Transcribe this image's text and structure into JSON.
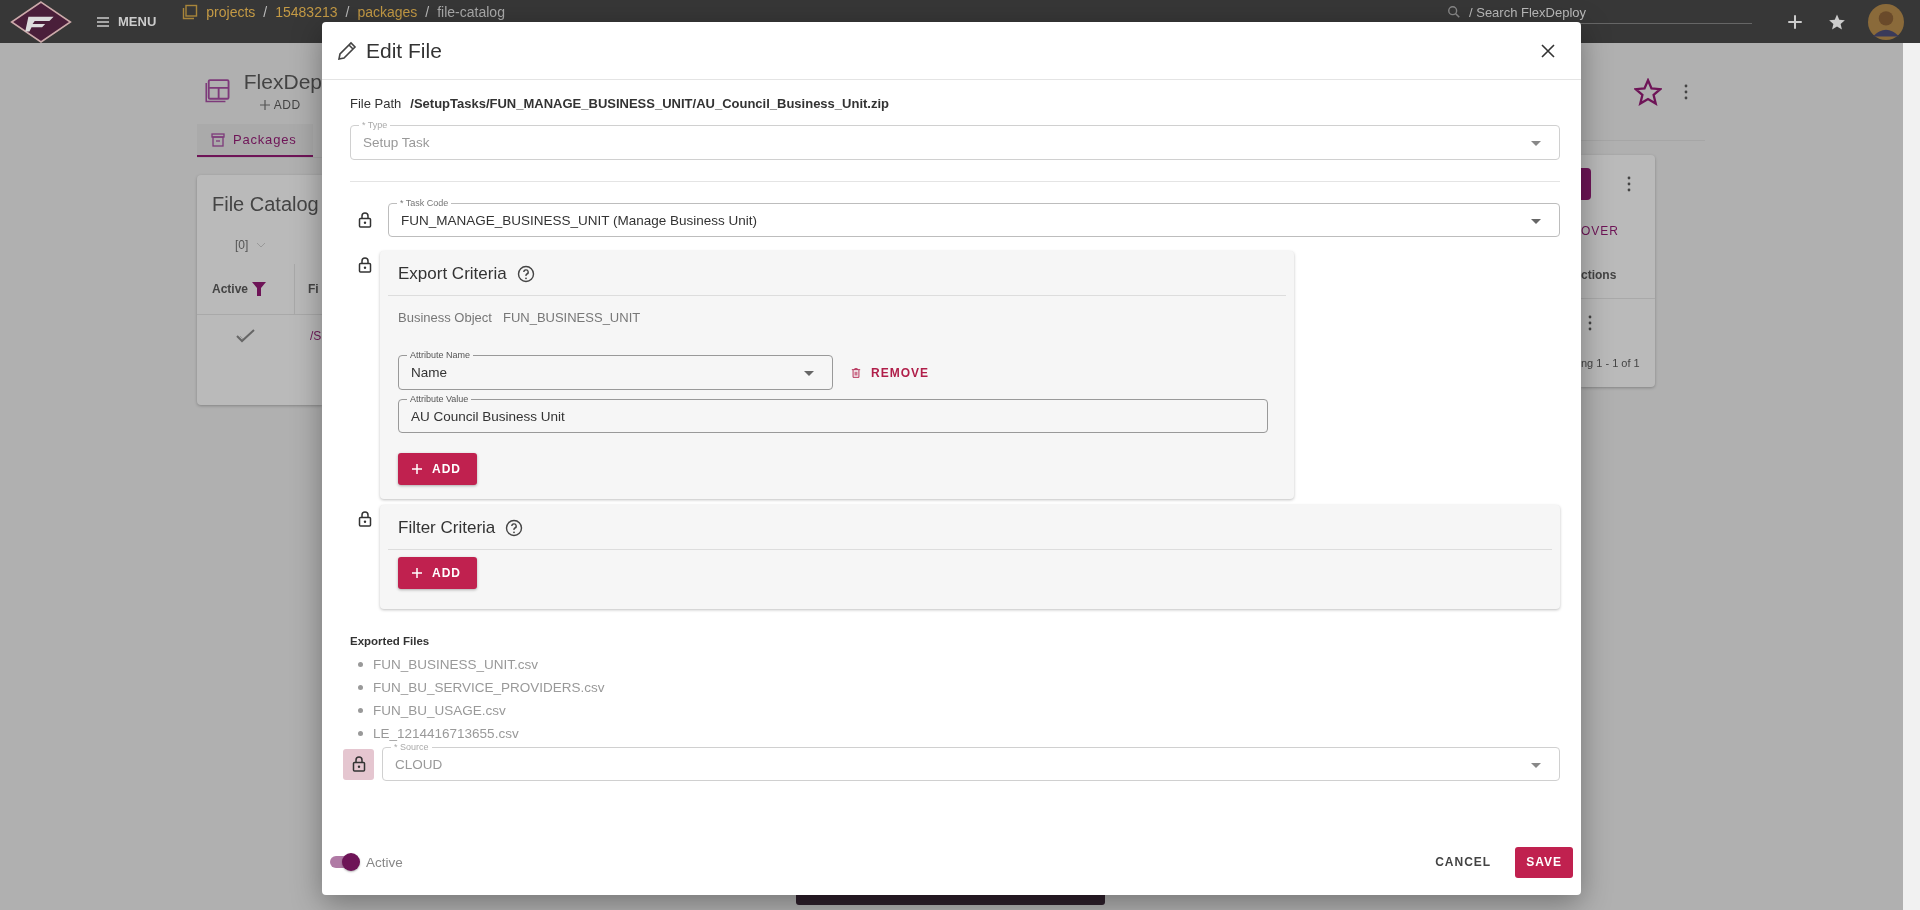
{
  "topbar": {
    "menu_label": "MENU",
    "breadcrumb": [
      "projects",
      "15483213",
      "packages",
      "file-catalog"
    ],
    "separator": "/",
    "search": {
      "placeholder": "/ Search FlexDeploy"
    }
  },
  "page": {
    "title": "FlexDep",
    "add_label": "ADD",
    "tabs": [
      {
        "label": "Packages",
        "selected": true
      }
    ],
    "card": {
      "title": "File Catalog",
      "count": "[0]",
      "columns": [
        {
          "label": "Active",
          "filtered": true
        },
        {
          "label": "Fi",
          "filtered": false
        }
      ],
      "row": {
        "active": true,
        "path": "/S"
      }
    },
    "right": {
      "action_label": "OVER",
      "column": "ctions",
      "paging": "ng 1 - 1 of 1"
    }
  },
  "dialog": {
    "title": "Edit File",
    "file_path_label": "File Path",
    "file_path": "/SetupTasks/FUN_MANAGE_BUSINESS_UNIT/AU_Council_Business_Unit.zip",
    "type": {
      "label": "* Type",
      "value": "Setup Task",
      "disabled": true
    },
    "task_code": {
      "label": "* Task Code",
      "value": "FUN_MANAGE_BUSINESS_UNIT (Manage Business Unit)",
      "disabled": false,
      "lock_disabled": false
    },
    "export_criteria": {
      "title": "Export Criteria",
      "lock_disabled": false,
      "business_object_label": "Business Object",
      "business_object": "FUN_BUSINESS_UNIT",
      "attributes": [
        {
          "name_label": "Attribute Name",
          "name": "Name",
          "remove_label": "REMOVE",
          "value_label": "Attribute Value",
          "value": "AU Council Business Unit"
        }
      ],
      "add_label": "ADD"
    },
    "filter_criteria": {
      "title": "Filter Criteria",
      "lock_disabled": false,
      "add_label": "ADD"
    },
    "exported_files_label": "Exported Files",
    "exported_files": [
      "FUN_BUSINESS_UNIT.csv",
      "FUN_BU_SERVICE_PROVIDERS.csv",
      "FUN_BU_USAGE.csv",
      "LE_1214416713655.csv"
    ],
    "source": {
      "label": "* Source",
      "value": "CLOUD",
      "disabled": true,
      "lock_disabled": true
    },
    "active": {
      "label": "Active",
      "on": true
    },
    "cancel_label": "CANCEL",
    "save_label": "SAVE"
  }
}
